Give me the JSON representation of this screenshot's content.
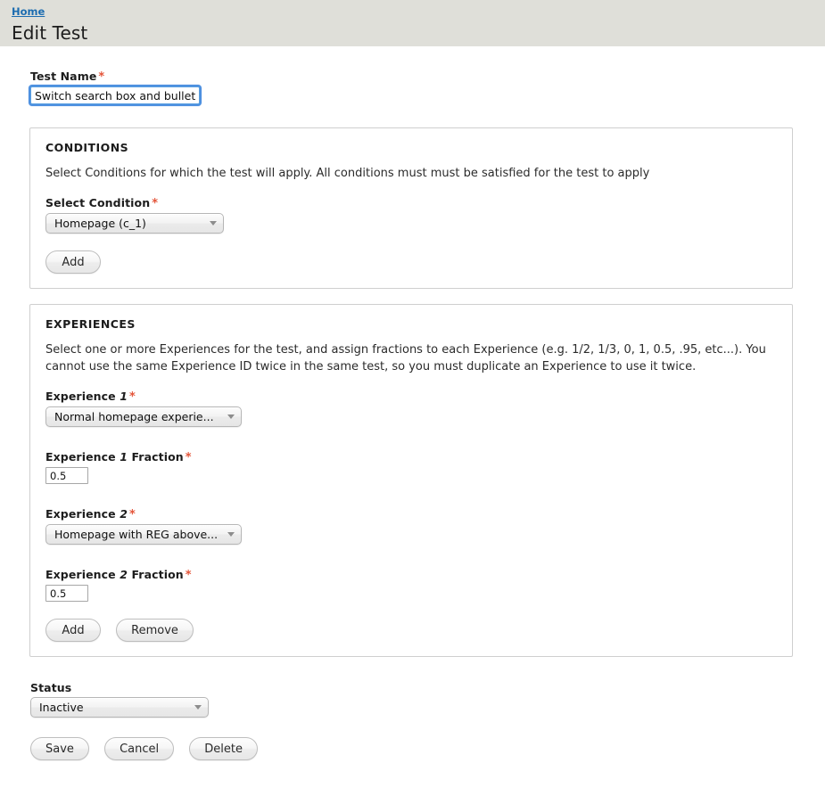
{
  "header": {
    "breadcrumb": "Home",
    "title": "Edit Test"
  },
  "test_name": {
    "label": "Test Name",
    "required_mark": "*",
    "value": "Switch search box and bullets",
    "placeholder": ""
  },
  "conditions": {
    "title": "CONDITIONS",
    "description": "Select Conditions for which the test will apply. All conditions must must be satisfied for the test to apply",
    "select_label": "Select Condition",
    "required_mark": "*",
    "selected": "Homepage (c_1)",
    "add_label": "Add"
  },
  "experiences": {
    "title": "EXPERIENCES",
    "description": "Select one or more Experiences for the test, and assign fractions to each Experience (e.g. 1/2, 1/3, 0, 1, 0.5, .95, etc...). You cannot use the same Experience ID twice in the same test, so you must duplicate an Experience to use it twice.",
    "required_mark": "*",
    "items": [
      {
        "label_prefix": "Experience",
        "index": "1",
        "selected": "Normal homepage experie...",
        "fraction_label_suffix": "Fraction",
        "fraction_value": "0.5"
      },
      {
        "label_prefix": "Experience",
        "index": "2",
        "selected": "Homepage with REG above...",
        "fraction_label_suffix": "Fraction",
        "fraction_value": "0.5"
      }
    ],
    "add_label": "Add",
    "remove_label": "Remove"
  },
  "status": {
    "label": "Status",
    "selected": "Inactive"
  },
  "actions": {
    "save": "Save",
    "cancel": "Cancel",
    "delete": "Delete"
  },
  "colors": {
    "header_bg": "#dfdfd9",
    "link": "#1c6cb0",
    "required": "#e4553a",
    "focus_ring": "#4d90e0",
    "panel_border": "#cfcfcf"
  }
}
